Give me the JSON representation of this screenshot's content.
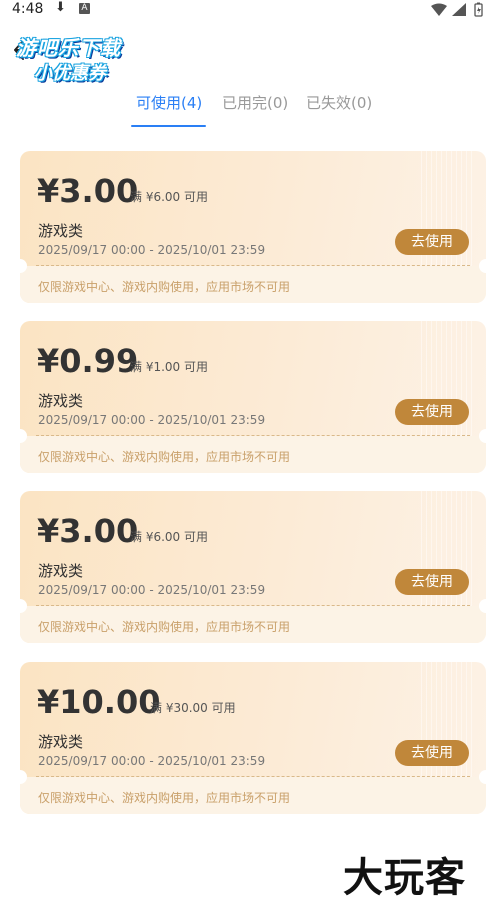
{
  "status_bar": {
    "time": "4:48",
    "download_glyph": "⬇",
    "app_glyph": "A"
  },
  "watermark": {
    "line1": "游吧乐下载",
    "line2": "小优惠券"
  },
  "tabs": [
    {
      "label": "可使用(4)",
      "active": true
    },
    {
      "label": "已用完(0)",
      "active": false
    },
    {
      "label": "已失效(0)",
      "active": false
    }
  ],
  "coupons": [
    {
      "amount": "¥3.00",
      "condition": "满 ¥6.00 可用",
      "category": "游戏类",
      "validity": "2025/09/17 00:00 - 2025/10/01 23:59",
      "button": "去使用",
      "note": "仅限游戏中心、游戏内购使用，应用市场不可用"
    },
    {
      "amount": "¥0.99",
      "condition": "满 ¥1.00 可用",
      "category": "游戏类",
      "validity": "2025/09/17 00:00 - 2025/10/01 23:59",
      "button": "去使用",
      "note": "仅限游戏中心、游戏内购使用，应用市场不可用"
    },
    {
      "amount": "¥3.00",
      "condition": "满 ¥6.00 可用",
      "category": "游戏类",
      "validity": "2025/09/17 00:00 - 2025/10/01 23:59",
      "button": "去使用",
      "note": "仅限游戏中心、游戏内购使用，应用市场不可用"
    },
    {
      "amount": "¥10.00",
      "condition": "满 ¥30.00 可用",
      "category": "游戏类",
      "validity": "2025/09/17 00:00 - 2025/10/01 23:59",
      "button": "去使用",
      "note": "仅限游戏中心、游戏内购使用，应用市场不可用"
    }
  ],
  "brand_mark": "大玩客",
  "colors": {
    "accent": "#2a7ff5",
    "button": "#c0873a",
    "card_bg": "#fbe4c3",
    "note_text": "#c9a06a"
  }
}
